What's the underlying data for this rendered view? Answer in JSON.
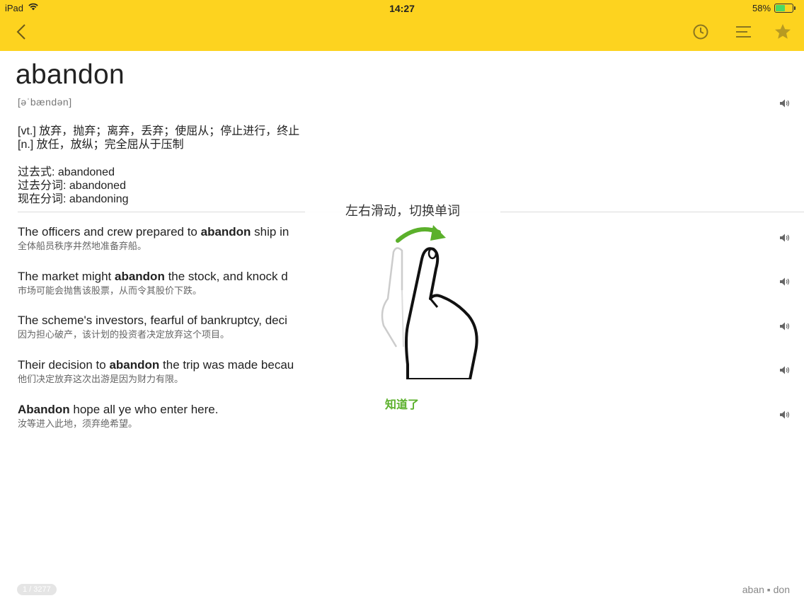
{
  "status_bar": {
    "carrier": "iPad",
    "time": "14:27",
    "battery_percent": "58%",
    "battery_level": 0.58,
    "battery_color": "#4cd964"
  },
  "nav_bar": {
    "background": "#fdd31f",
    "back_icon": "chevron-left-icon",
    "history_icon": "clock-icon",
    "list_icon": "menu-lines-icon",
    "favorite_icon": "star-icon"
  },
  "word": {
    "headword": "abandon",
    "phonetic": "[əˈbændən]",
    "definitions": [
      "[vt.] 放弃，抛弃；离弃，丢弃；使屈从；停止进行，终止",
      "[n.] 放任，放纵；完全屈从于压制"
    ],
    "inflections": [
      "过去式: abandoned",
      "过去分词: abandoned",
      "现在分词: abandoning"
    ]
  },
  "examples": [
    {
      "before": "The officers and crew prepared to ",
      "bold": "abandon",
      "after": " ship in",
      "translation": "全体船员秩序井然地准备弃船。"
    },
    {
      "before": "The market might ",
      "bold": "abandon",
      "after": " the stock, and knock d",
      "translation": "市场可能会抛售该股票，从而令其股价下跌。"
    },
    {
      "before": "The scheme's investors, fearful of bankruptcy, deci",
      "bold": "",
      "after": "",
      "translation": "因为担心破产，该计划的投资者决定放弃这个项目。"
    },
    {
      "before": "Their decision to ",
      "bold": "abandon",
      "after": " the trip was made becau",
      "translation": "他们决定放弃这次出游是因为财力有限。"
    },
    {
      "before": "",
      "bold": "Abandon",
      "after": " hope all ye who enter here.",
      "translation": "汝等进入此地，须弃绝希望。"
    }
  ],
  "footer": {
    "page_indicator": "1 / 3277",
    "syllables": "aban ▪ don"
  },
  "overlay": {
    "title": "左右滑动，切换单词",
    "gesture_icon": "swipe-hand-icon",
    "dismiss_label": "知道了",
    "accent_color": "#5bb02b"
  }
}
